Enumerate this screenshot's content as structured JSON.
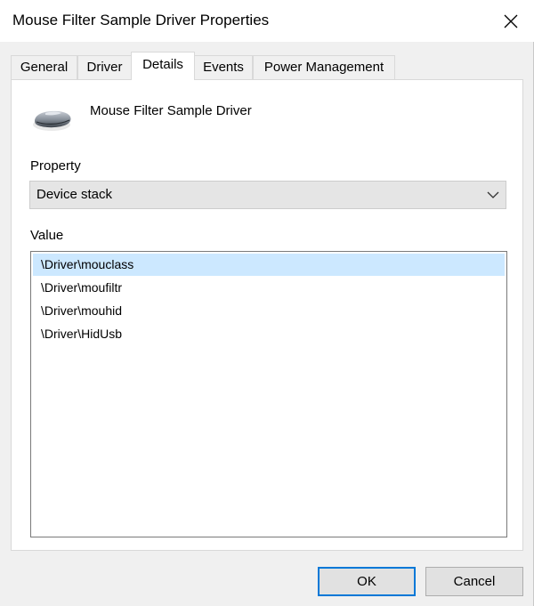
{
  "window": {
    "title": "Mouse Filter Sample Driver Properties",
    "close_icon": "close-icon"
  },
  "tabs": [
    {
      "label": "General",
      "active": false
    },
    {
      "label": "Driver",
      "active": false
    },
    {
      "label": "Details",
      "active": true
    },
    {
      "label": "Events",
      "active": false
    },
    {
      "label": "Power Management",
      "active": false
    }
  ],
  "details": {
    "device_icon": "mouse-icon",
    "device_name": "Mouse Filter Sample Driver",
    "property_label": "Property",
    "property_selected": "Device stack",
    "value_label": "Value",
    "values": [
      {
        "text": "\\Driver\\mouclass",
        "selected": true
      },
      {
        "text": "\\Driver\\moufiltr",
        "selected": false
      },
      {
        "text": "\\Driver\\mouhid",
        "selected": false
      },
      {
        "text": "\\Driver\\HidUsb",
        "selected": false
      }
    ]
  },
  "buttons": {
    "ok": "OK",
    "cancel": "Cancel"
  },
  "colors": {
    "selection": "#cce8ff",
    "default_button_border": "#0078d7",
    "dialog_background": "#f0f0f0"
  }
}
